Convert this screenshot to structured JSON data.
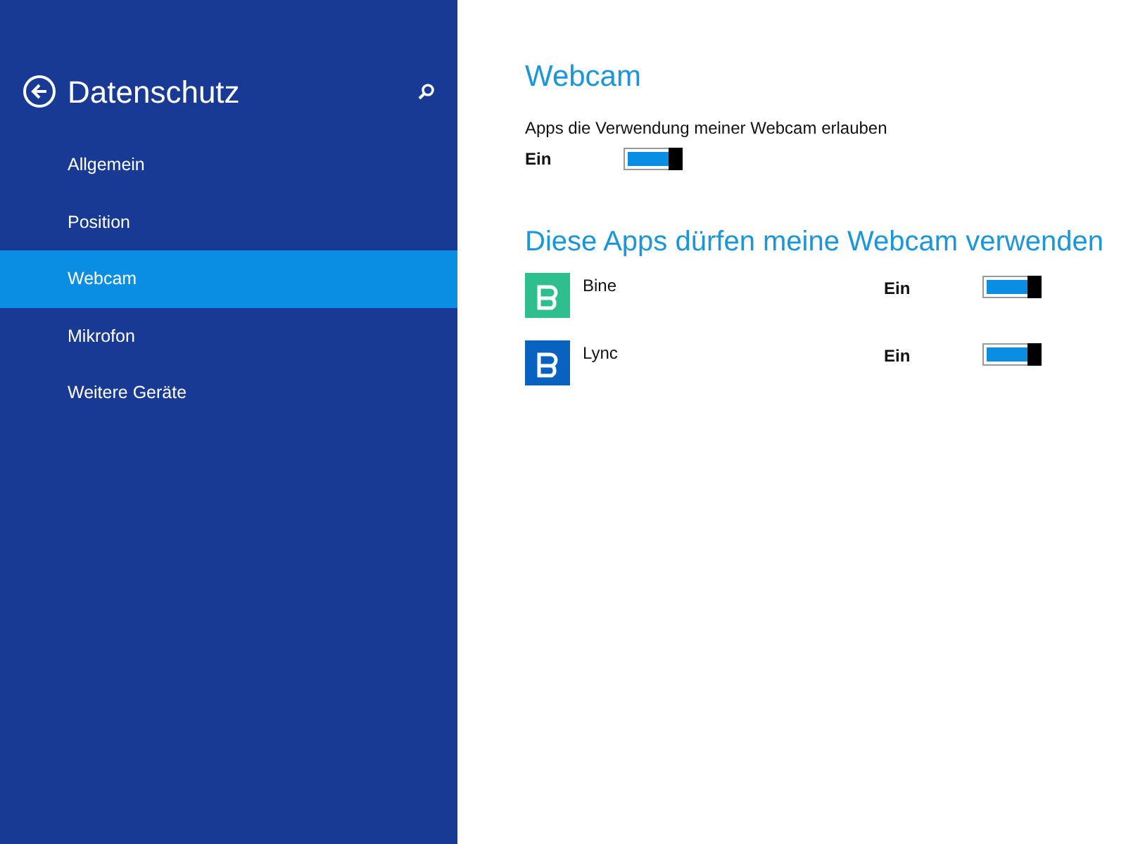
{
  "sidebar": {
    "title": "Datenschutz",
    "items": [
      {
        "label": "Allgemein",
        "selected": false
      },
      {
        "label": "Position",
        "selected": false
      },
      {
        "label": "Webcam",
        "selected": true
      },
      {
        "label": "Mikrofon",
        "selected": false
      },
      {
        "label": "Weitere Geräte",
        "selected": false
      }
    ]
  },
  "main": {
    "title": "Webcam",
    "setting_label": "Apps die Verwendung meiner Webcam erlauben",
    "setting_state": "Ein",
    "setting_on": true,
    "apps_heading": "Diese Apps dürfen meine Webcam verwenden",
    "apps": [
      {
        "name": "Bine",
        "color": "#2fbf8f",
        "state": "Ein",
        "on": true
      },
      {
        "name": "Lync",
        "color": "#0a62c0",
        "state": "Ein",
        "on": true
      }
    ]
  }
}
